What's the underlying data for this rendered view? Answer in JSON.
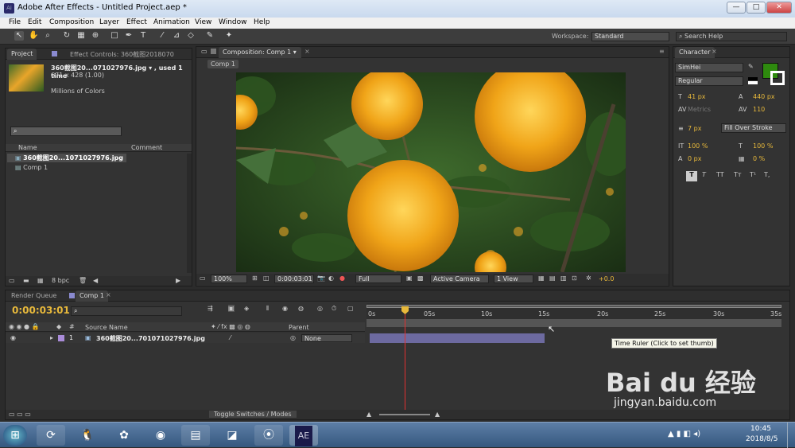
{
  "window": {
    "app_icon": "Ai",
    "title": "Adobe After Effects - Untitled Project.aep *",
    "min": "—",
    "max": "□",
    "close": "✕"
  },
  "menu": [
    "File",
    "Edit",
    "Composition",
    "Layer",
    "Effect",
    "Animation",
    "View",
    "Window",
    "Help"
  ],
  "toolbar": {
    "workspace_label": "Workspace:",
    "workspace_value": "Standard",
    "search_help": "Search Help"
  },
  "project": {
    "tab_project": "Project",
    "tab_effect": "Effect Controls: 360截图2018070",
    "item_name": "360截图20...071027976.jpg ▾ , used 1 time",
    "item_dims": "671 x 428 (1.00)",
    "item_colors": "Millions of Colors",
    "col_name": "Name",
    "col_comment": "Comment",
    "rows": [
      "360截图20...1071027976.jpg",
      "Comp 1"
    ],
    "bpc": "8 bpc"
  },
  "comp": {
    "tab": "Composition: Comp 1",
    "subtab": "Comp 1",
    "zoom": "100%",
    "time": "0:00:03:01",
    "res": "Full",
    "camera": "Active Camera",
    "view": "1 View",
    "exposure": "+0.0"
  },
  "character": {
    "tab": "Character",
    "font": "SimHei",
    "style": "Regular",
    "size": "41 px",
    "leading": "440 px",
    "kerning": "Metrics",
    "tracking": "110",
    "stroke": "7 px",
    "stroke_mode": "Fill Over Stroke",
    "vscale": "100 %",
    "hscale": "100 %",
    "baseline": "0 px",
    "tsume": "0 %",
    "color": "#2e8a0e",
    "styles": [
      "T",
      "T",
      "TT",
      "Tт",
      "T¹",
      "T,"
    ]
  },
  "timeline": {
    "tab_render": "Render Queue",
    "tab_comp": "Comp 1",
    "time": "0:00:03:01",
    "search_icon": "⌕",
    "col_source": "Source Name",
    "col_parent": "Parent",
    "layer_num": "1",
    "layer_name": "360截图20...701071027976.jpg",
    "parent": "None",
    "ruler": [
      "0s",
      "05s",
      "10s",
      "15s",
      "20s",
      "25s",
      "30s",
      "35s"
    ],
    "tooltip": "Time Ruler (Click to set thumb)",
    "toggle": "Toggle Switches / Modes"
  },
  "taskbar": {
    "time": "10:45",
    "date": "2018/8/5",
    "ae": "AE"
  },
  "watermark": {
    "brand": "Bai du 经验",
    "url": "jingyan.baidu.com"
  }
}
